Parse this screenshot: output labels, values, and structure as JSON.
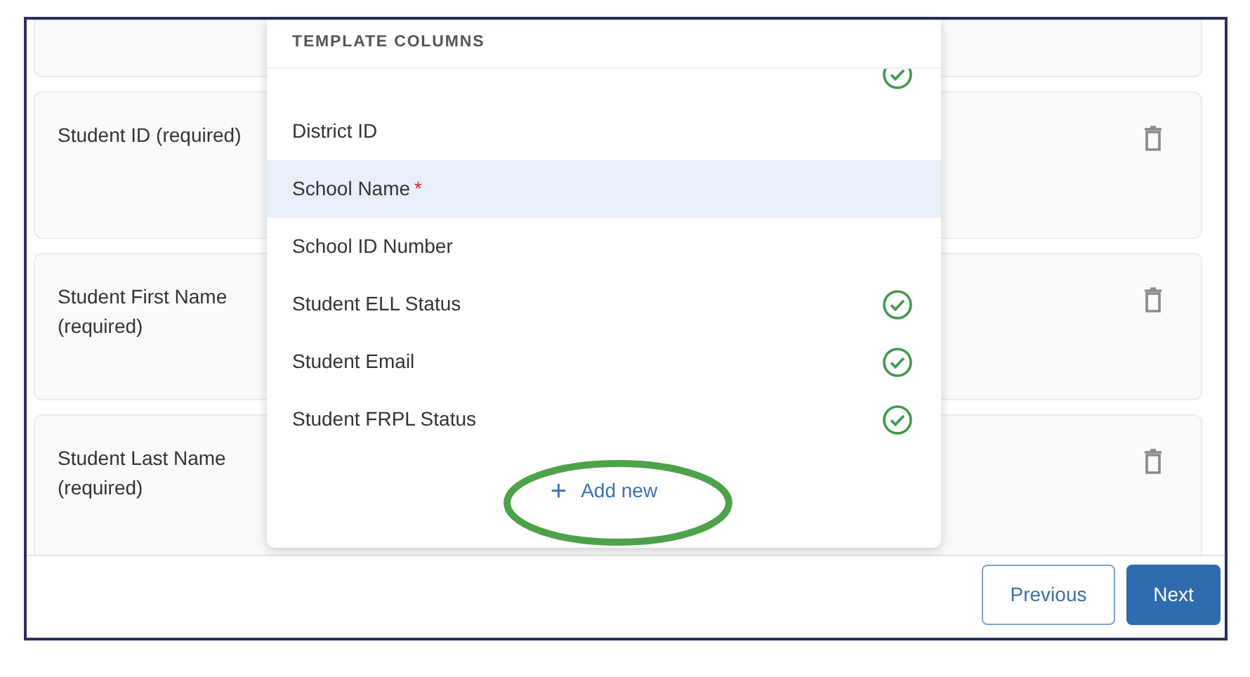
{
  "mapping_cards": [
    {
      "deletable": false
    },
    {
      "label": "Student ID (required)",
      "deletable": true
    },
    {
      "label": "Student First Name (required)",
      "deletable": true
    },
    {
      "label": "Student Last Name (required)",
      "deletable": true
    }
  ],
  "dropdown": {
    "title": "TEMPLATE COLUMNS",
    "items": [
      {
        "mapped": true,
        "selected": false
      },
      {
        "label": "District ID",
        "mapped": false,
        "selected": false
      },
      {
        "label": "School Name",
        "mapped": false,
        "selected": true,
        "required_mark": "*"
      },
      {
        "label": "School ID Number",
        "mapped": false,
        "selected": false
      },
      {
        "label": "Student ELL Status",
        "mapped": true,
        "selected": false
      },
      {
        "label": "Student Email",
        "mapped": true,
        "selected": false
      },
      {
        "label": "Student FRPL Status",
        "mapped": true,
        "selected": false
      }
    ],
    "add_button": {
      "icon": "+",
      "label": "Add new"
    }
  },
  "annotation": {
    "kind": "ellipse"
  },
  "footer": {
    "buttons": [
      {
        "label": "Previous",
        "kind": "secondary"
      },
      {
        "label": "Next",
        "kind": "primary"
      }
    ]
  }
}
